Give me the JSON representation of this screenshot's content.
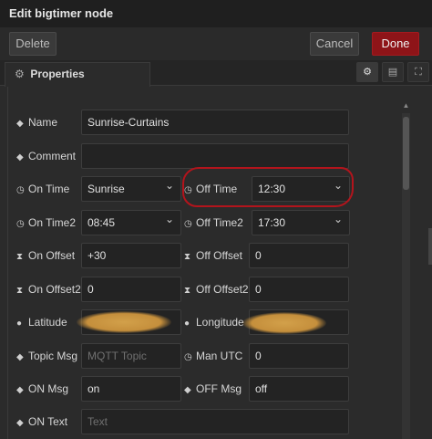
{
  "dialog": {
    "title": "Edit bigtimer node"
  },
  "actions": {
    "delete_label": "Delete",
    "cancel_label": "Cancel",
    "done_label": "Done"
  },
  "tab": {
    "label": "Properties",
    "icon": "gear-icon"
  },
  "tab_buttons": [
    "gear-icon",
    "document-icon",
    "frame-icon"
  ],
  "accent": {
    "done_button": "#8e1418",
    "annotation": "#b3141c"
  },
  "fields": {
    "name": {
      "label": "Name",
      "value": "Sunrise-Curtains"
    },
    "comment": {
      "label": "Comment",
      "value": ""
    },
    "on_time": {
      "label": "On Time",
      "value": "Sunrise"
    },
    "off_time": {
      "label": "Off Time",
      "value": "12:30"
    },
    "on_time2": {
      "label": "On Time2",
      "value": "08:45"
    },
    "off_time2": {
      "label": "Off Time2",
      "value": "17:30"
    },
    "on_offset": {
      "label": "On Offset",
      "value": "+30"
    },
    "off_offset": {
      "label": "Off Offset",
      "value": "0"
    },
    "on_offset2": {
      "label": "On Offset2",
      "value": "0"
    },
    "off_offset2": {
      "label": "Off Offset2",
      "value": "0"
    },
    "latitude": {
      "label": "Latitude"
    },
    "longitude": {
      "label": "Longitude"
    },
    "topic_msg": {
      "label": "Topic Msg",
      "placeholder": "MQTT Topic"
    },
    "man_utc": {
      "label": "Man UTC",
      "value": "0"
    },
    "on_msg": {
      "label": "ON Msg",
      "value": "on"
    },
    "off_msg": {
      "label": "OFF Msg",
      "value": "off"
    },
    "on_text": {
      "label": "ON Text",
      "placeholder": "Text"
    }
  }
}
